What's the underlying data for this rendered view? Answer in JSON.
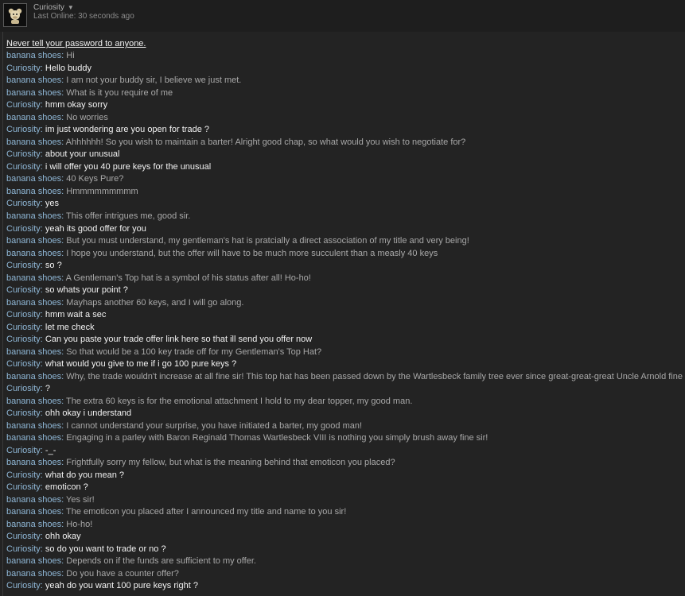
{
  "header": {
    "contact_name": "Curiosity",
    "status": "Last Online: 30 seconds ago"
  },
  "warning": "Never tell your password to anyone.",
  "messages": [
    {
      "sender": "banana shoes",
      "text": "Hi",
      "me": false
    },
    {
      "sender": "Curiosity",
      "text": "Hello buddy",
      "me": true
    },
    {
      "sender": "banana shoes",
      "text": "I am not your buddy sir, I believe we just met.",
      "me": false
    },
    {
      "sender": "banana shoes",
      "text": "What is it you require of me",
      "me": false
    },
    {
      "sender": "Curiosity",
      "text": "hmm okay sorry",
      "me": true
    },
    {
      "sender": "banana shoes",
      "text": "No worries",
      "me": false
    },
    {
      "sender": "Curiosity",
      "text": "im just wondering are you open for trade ?",
      "me": true
    },
    {
      "sender": "banana shoes",
      "text": "Ahhhhhh! So you wish to maintain a barter! Alright good chap, so what would you wish to negotiate for?",
      "me": false
    },
    {
      "sender": "Curiosity",
      "text": "about your unusual",
      "me": true
    },
    {
      "sender": "Curiosity",
      "text": "i will offer you 40 pure keys for the unusual",
      "me": true
    },
    {
      "sender": "banana shoes",
      "text": "40 Keys Pure?",
      "me": false
    },
    {
      "sender": "banana shoes",
      "text": "Hmmmmmmmmm",
      "me": false
    },
    {
      "sender": "Curiosity",
      "text": "yes",
      "me": true
    },
    {
      "sender": "banana shoes",
      "text": "This offer intrigues me, good sir.",
      "me": false
    },
    {
      "sender": "Curiosity",
      "text": "yeah its good offer for you",
      "me": true
    },
    {
      "sender": "banana shoes",
      "text": "But you must understand, my gentleman's hat is pratcially a direct association of my title and very being!",
      "me": false
    },
    {
      "sender": "banana shoes",
      "text": "I hope you understand, but the offer will have to be much more succulent than a measly 40 keys",
      "me": false
    },
    {
      "sender": "Curiosity",
      "text": "so ?",
      "me": true
    },
    {
      "sender": "banana shoes",
      "text": "A Gentleman's Top hat is a symbol of his status after all! Ho-ho!",
      "me": false
    },
    {
      "sender": "Curiosity",
      "text": "so whats your point ?",
      "me": true
    },
    {
      "sender": "banana shoes",
      "text": "Mayhaps another 60 keys, and I will go along.",
      "me": false
    },
    {
      "sender": "Curiosity",
      "text": "hmm wait a sec",
      "me": true
    },
    {
      "sender": "Curiosity",
      "text": "let me check",
      "me": true
    },
    {
      "sender": "Curiosity",
      "text": "Can you paste your trade offer link here so that ill send you offer now",
      "me": true
    },
    {
      "sender": "banana shoes",
      "text": "So that would be a 100 key trade off for my Gentleman's Top Hat?",
      "me": false
    },
    {
      "sender": "Curiosity",
      "text": "what would you give to me if i go 100 pure keys ?",
      "me": true
    },
    {
      "sender": "banana shoes",
      "text": "Why, the trade wouldn't increase at all fine sir! This top hat has been passed down by the Wartlesbeck family tree ever since great-great-great Uncle Arnold fine sir!",
      "me": false
    },
    {
      "sender": "Curiosity",
      "text": "?",
      "me": true
    },
    {
      "sender": "banana shoes",
      "text": "The extra 60 keys is for the emotional attachment I hold to my dear topper, my good man.",
      "me": false
    },
    {
      "sender": "Curiosity",
      "text": "ohh okay i understand",
      "me": true
    },
    {
      "sender": "banana shoes",
      "text": "I cannot understand your surprise, you have initiated a barter, my good man!",
      "me": false
    },
    {
      "sender": "banana shoes",
      "text": "Engaging in a parley with Baron Reginald Thomas Wartlesbeck VIII is nothing you simply brush away fine sir!",
      "me": false
    },
    {
      "sender": "Curiosity",
      "text": "-_-",
      "me": true
    },
    {
      "sender": "banana shoes",
      "text": "Frightfully sorry my fellow, but what is the meaning behind that emoticon you placed?",
      "me": false
    },
    {
      "sender": "Curiosity",
      "text": "what do you mean ?",
      "me": true
    },
    {
      "sender": "Curiosity",
      "text": "emoticon ?",
      "me": true
    },
    {
      "sender": "banana shoes",
      "text": "Yes sir!",
      "me": false
    },
    {
      "sender": "banana shoes",
      "text": "The emoticon you placed after I announced my title and name to you sir!",
      "me": false
    },
    {
      "sender": "banana shoes",
      "text": "Ho-ho!",
      "me": false
    },
    {
      "sender": "Curiosity",
      "text": "ohh okay",
      "me": true
    },
    {
      "sender": "Curiosity",
      "text": "so do you want to trade or no ?",
      "me": true
    },
    {
      "sender": "banana shoes",
      "text": "Depends on if the funds are sufficient to my offer.",
      "me": false
    },
    {
      "sender": "banana shoes",
      "text": "Do you have a counter offer?",
      "me": false
    },
    {
      "sender": "Curiosity",
      "text": "yeah do you want 100 pure keys right ?",
      "me": true
    }
  ]
}
